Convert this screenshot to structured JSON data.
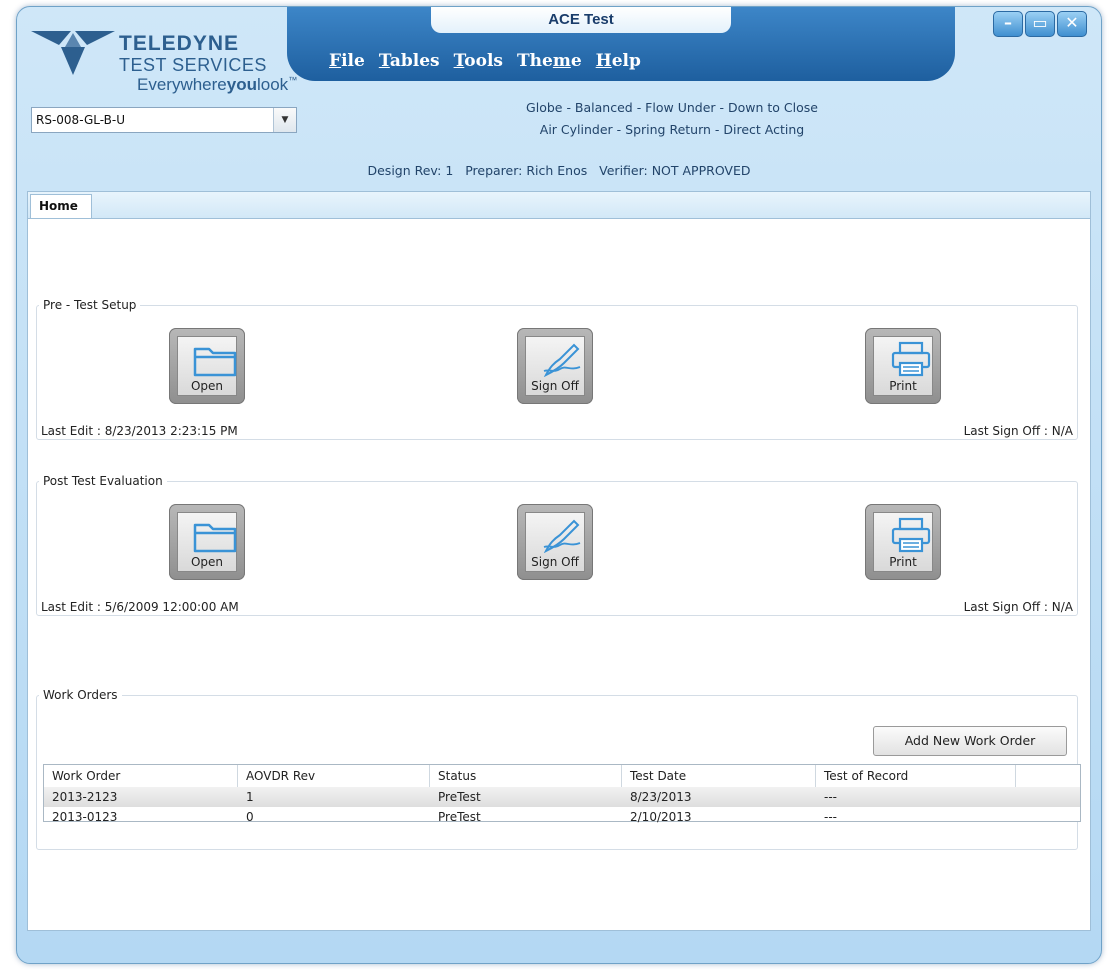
{
  "window": {
    "title": "ACE Test",
    "controls": {
      "minimize": "–",
      "maximize": "▭",
      "close": "✕"
    }
  },
  "menu": {
    "items": [
      {
        "pre": "",
        "accel": "F",
        "post": "ile"
      },
      {
        "pre": "",
        "accel": "T",
        "post": "ables"
      },
      {
        "pre": "",
        "accel": "T",
        "post": "ools"
      },
      {
        "pre": "The",
        "accel": "m",
        "post": "e"
      },
      {
        "pre": "",
        "accel": "H",
        "post": "elp"
      }
    ]
  },
  "logo": {
    "line1": "TELEDYNE",
    "line2": "TEST SERVICES",
    "line3_a": "Everywhere",
    "line3_b": "you",
    "line3_c": "look",
    "tm": "™"
  },
  "valve_select": {
    "value": "RS-008-GL-B-U"
  },
  "description": {
    "line1": "Globe - Balanced - Flow Under - Down to Close",
    "line2": "Air Cylinder - Spring Return - Direct Acting"
  },
  "revision_info": "Design Rev: 1   Preparer: Rich Enos   Verifier: NOT APPROVED",
  "tabs": [
    {
      "label": "Home"
    }
  ],
  "pre_test": {
    "legend": "Pre - Test Setup",
    "open_label": "Open",
    "signoff_label": "Sign Off",
    "print_label": "Print",
    "last_edit": "Last Edit : 8/23/2013 2:23:15 PM",
    "last_signoff": "Last Sign Off : N/A"
  },
  "post_test": {
    "legend": "Post Test Evaluation",
    "open_label": "Open",
    "signoff_label": "Sign Off",
    "print_label": "Print",
    "last_edit": "Last Edit : 5/6/2009 12:00:00 AM",
    "last_signoff": "Last Sign Off : N/A"
  },
  "work_orders": {
    "legend": "Work Orders",
    "add_label": "Add New Work Order",
    "columns": [
      "Work Order",
      "AOVDR Rev",
      "Status",
      "Test Date",
      "Test of Record"
    ],
    "rows": [
      [
        "2013-2123",
        "1",
        "PreTest",
        "8/23/2013",
        "---"
      ],
      [
        "2013-0123",
        "0",
        "PreTest",
        "2/10/2013",
        "---"
      ]
    ]
  },
  "colors": {
    "banner": "#1e5f9f",
    "frame": "#b4d8f3",
    "icon_blue": "#3a93d6"
  }
}
